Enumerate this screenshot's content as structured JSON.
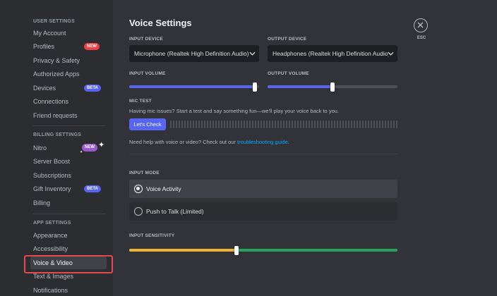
{
  "sidebar": {
    "user_settings_header": "USER SETTINGS",
    "user_items": [
      {
        "label": "My Account"
      },
      {
        "label": "Profiles",
        "badge": "NEW"
      },
      {
        "label": "Privacy & Safety"
      },
      {
        "label": "Authorized Apps"
      },
      {
        "label": "Devices",
        "badge": "BETA"
      },
      {
        "label": "Connections"
      },
      {
        "label": "Friend requests"
      }
    ],
    "billing_settings_header": "BILLING SETTINGS",
    "billing_items": [
      {
        "label": "Nitro",
        "badge": "NEW"
      },
      {
        "label": "Server Boost"
      },
      {
        "label": "Subscriptions"
      },
      {
        "label": "Gift Inventory",
        "badge": "BETA"
      },
      {
        "label": "Billing"
      }
    ],
    "app_settings_header": "APP SETTINGS",
    "app_items": [
      {
        "label": "Appearance"
      },
      {
        "label": "Accessibility"
      },
      {
        "label": "Voice & Video",
        "active": true
      },
      {
        "label": "Text & Images"
      },
      {
        "label": "Notifications"
      }
    ]
  },
  "main": {
    "title": "Voice Settings",
    "input_device_label": "INPUT DEVICE",
    "input_device_value": "Microphone (Realtek High Definition Audio)",
    "output_device_label": "OUTPUT DEVICE",
    "output_device_value": "Headphones (Realtek High Definition Audio)",
    "input_volume_label": "INPUT VOLUME",
    "input_volume_fraction": 0.97,
    "output_volume_label": "OUTPUT VOLUME",
    "output_volume_fraction": 0.5,
    "mic_test_label": "MIC TEST",
    "mic_test_description": "Having mic issues? Start a test and say something fun—we'll play your voice back to you.",
    "lets_check_button": "Let's Check",
    "help_text_prefix": "Need help with voice or video? Check out our ",
    "help_link": "troubleshooting guide",
    "help_text_suffix": ".",
    "input_mode_label": "INPUT MODE",
    "voice_activity_label": "Voice Activity",
    "push_to_talk_label": "Push to Talk (Limited)",
    "input_sensitivity_label": "INPUT SENSITIVITY",
    "input_sensitivity_fraction": 0.4,
    "close_label": "ESC"
  },
  "colors": {
    "accent": "#5865f2",
    "highlight_box": "#e5484d",
    "sensitivity_low": "#f0b232",
    "sensitivity_high": "#23a55a"
  },
  "icons": {
    "select_chevron": "chevron-down-icon",
    "close": "close-icon",
    "nitro_sparkle": "sparkle-icon"
  }
}
